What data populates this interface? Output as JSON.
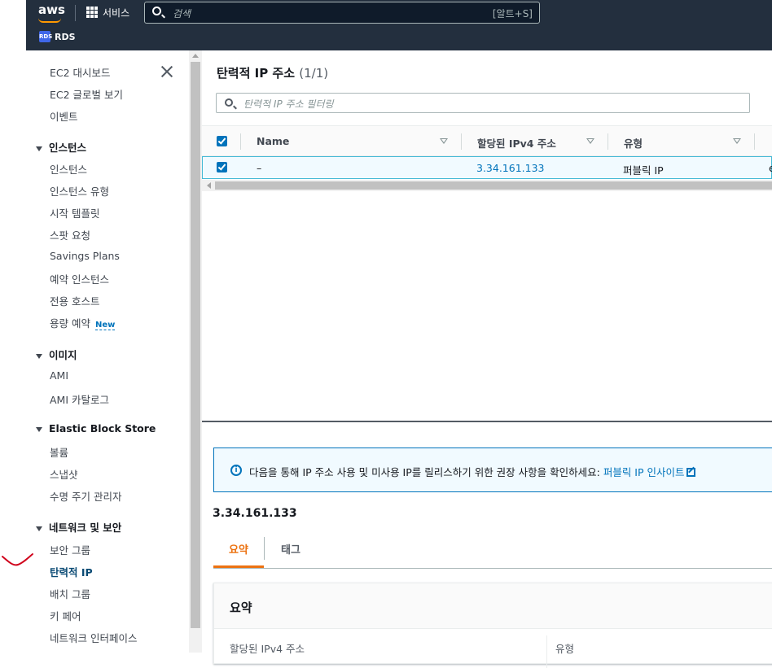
{
  "topbar": {
    "logo": "aws",
    "services_label": "서비스",
    "search_placeholder": "검색",
    "search_shortcut": "[알트+S]",
    "favorite": "RDS",
    "favorite_icon_text": "RDS"
  },
  "sidebar": {
    "items_top": [
      "EC2 대시보드",
      "EC2 글로벌 보기",
      "이벤트"
    ],
    "groups": [
      {
        "title": "인스턴스",
        "items": [
          "인스턴스",
          "인스턴스 유형",
          "시작 템플릿",
          "스팟 요청",
          "Savings Plans",
          "예약 인스턴스",
          "전용 호스트",
          "용량 예약"
        ],
        "badge": "New"
      },
      {
        "title": "이미지",
        "items": [
          "AMI",
          "AMI 카탈로그"
        ]
      },
      {
        "title": "Elastic Block Store",
        "items": [
          "볼륨",
          "스냅샷",
          "수명 주기 관리자"
        ]
      },
      {
        "title": "네트워크 및 보안",
        "items": [
          "보안 그룹",
          "탄력적 IP",
          "배치 그룹",
          "키 페어",
          "네트워크 인터페이스"
        ]
      }
    ]
  },
  "main": {
    "title": "탄력적 IP 주소",
    "count": "(1/1)",
    "filter_placeholder": "탄력적 IP 주소 필터링",
    "columns": [
      "Name",
      "할당된 IPv4 주소",
      "유형"
    ],
    "row": {
      "name": "–",
      "ip": "3.34.161.133",
      "type": "퍼블릭 IP",
      "next_col_fragment": "e"
    },
    "info_text": "다음을 통해 IP 주소 사용 및 미사용 IP를 릴리스하기 위한 권장 사항을 확인하세요:",
    "info_link": "퍼블릭 IP 인사이트",
    "detail_title": "3.34.161.133",
    "tabs": [
      "요약",
      "태그"
    ],
    "panel_title": "요약",
    "panel_labels": [
      "할당된 IPv4 주소",
      "유형"
    ]
  },
  "colors": {
    "topbar_bg": "#232f3e",
    "accent_orange": "#ec7211",
    "link_blue": "#0073bb",
    "annotation_red": "#d0021b"
  }
}
